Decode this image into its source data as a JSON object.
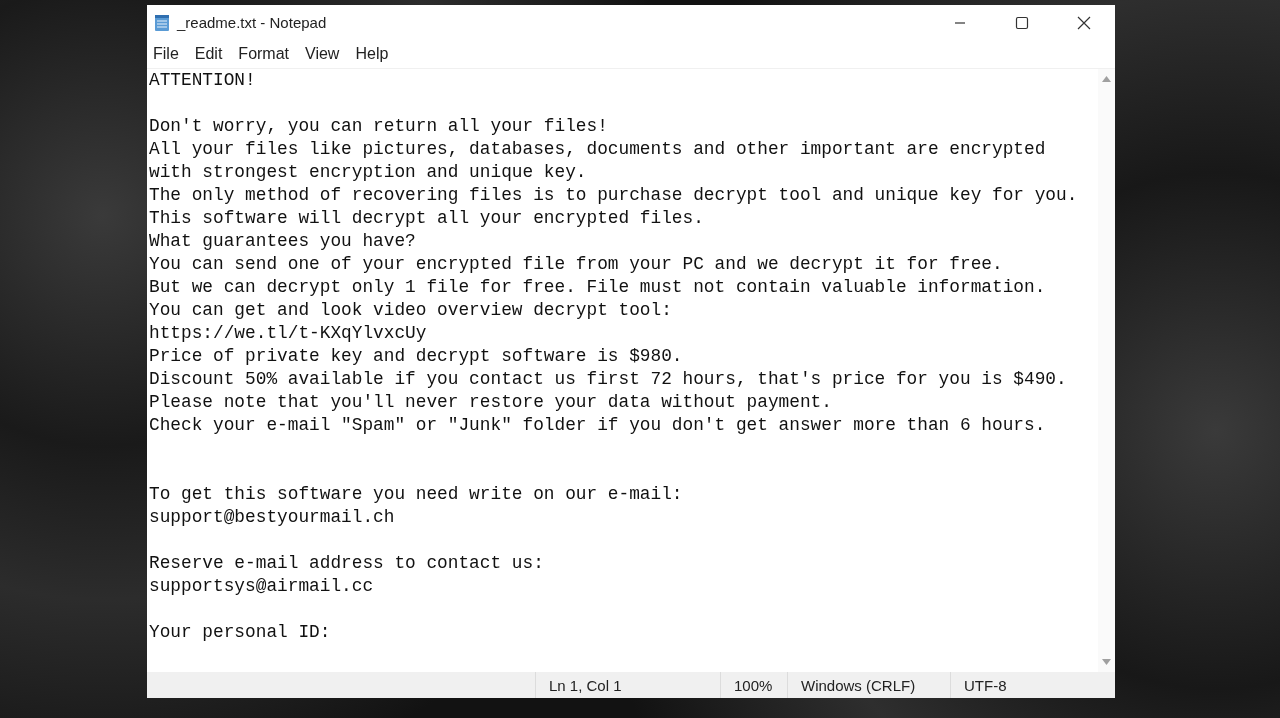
{
  "window": {
    "title": "_readme.txt - Notepad"
  },
  "menu": [
    "File",
    "Edit",
    "Format",
    "View",
    "Help"
  ],
  "document": {
    "lines": [
      {
        "kind": "text",
        "text": "ATTENTION!"
      },
      {
        "kind": "blank"
      },
      {
        "kind": "text",
        "text": "Don't worry, you can return all your files!"
      },
      {
        "kind": "text",
        "text": "All your files like pictures, databases, documents and other important are encrypted"
      },
      {
        "kind": "text",
        "text": "with strongest encryption and unique key."
      },
      {
        "kind": "text",
        "text": "The only method of recovering files is to purchase decrypt tool and unique key for you."
      },
      {
        "kind": "text",
        "text": "This software will decrypt all your encrypted files."
      },
      {
        "kind": "text",
        "text": "What guarantees you have?"
      },
      {
        "kind": "text",
        "text": "You can send one of your encrypted file from your PC and we decrypt it for free."
      },
      {
        "kind": "text",
        "text": "But we can decrypt only 1 file for free. File must not contain valuable information."
      },
      {
        "kind": "text",
        "text": "You can get and look video overview decrypt tool:"
      },
      {
        "kind": "text",
        "text": "https://we.tl/t-KXqYlvxcUy"
      },
      {
        "kind": "text",
        "text": "Price of private key and decrypt software is $980."
      },
      {
        "kind": "text",
        "text": "Discount 50% available if you contact us first 72 hours, that's price for you is $490."
      },
      {
        "kind": "text",
        "text": "Please note that you'll never restore your data without payment."
      },
      {
        "kind": "text",
        "text": "Check your e-mail \"Spam\" or \"Junk\" folder if you don't get answer more than 6 hours."
      },
      {
        "kind": "blank"
      },
      {
        "kind": "blank"
      },
      {
        "kind": "text",
        "text": "To get this software you need write on our e-mail:"
      },
      {
        "kind": "text",
        "text": "support@bestyourmail.ch"
      },
      {
        "kind": "blank"
      },
      {
        "kind": "text",
        "text": "Reserve e-mail address to contact us:"
      },
      {
        "kind": "text",
        "text": "supportsys@airmail.cc"
      },
      {
        "kind": "blank"
      },
      {
        "kind": "text",
        "text": "Your personal ID:"
      }
    ]
  },
  "status_bar": [
    "Ln 1, Col 1",
    "100%",
    "Windows (CRLF)",
    "UTF-8"
  ]
}
